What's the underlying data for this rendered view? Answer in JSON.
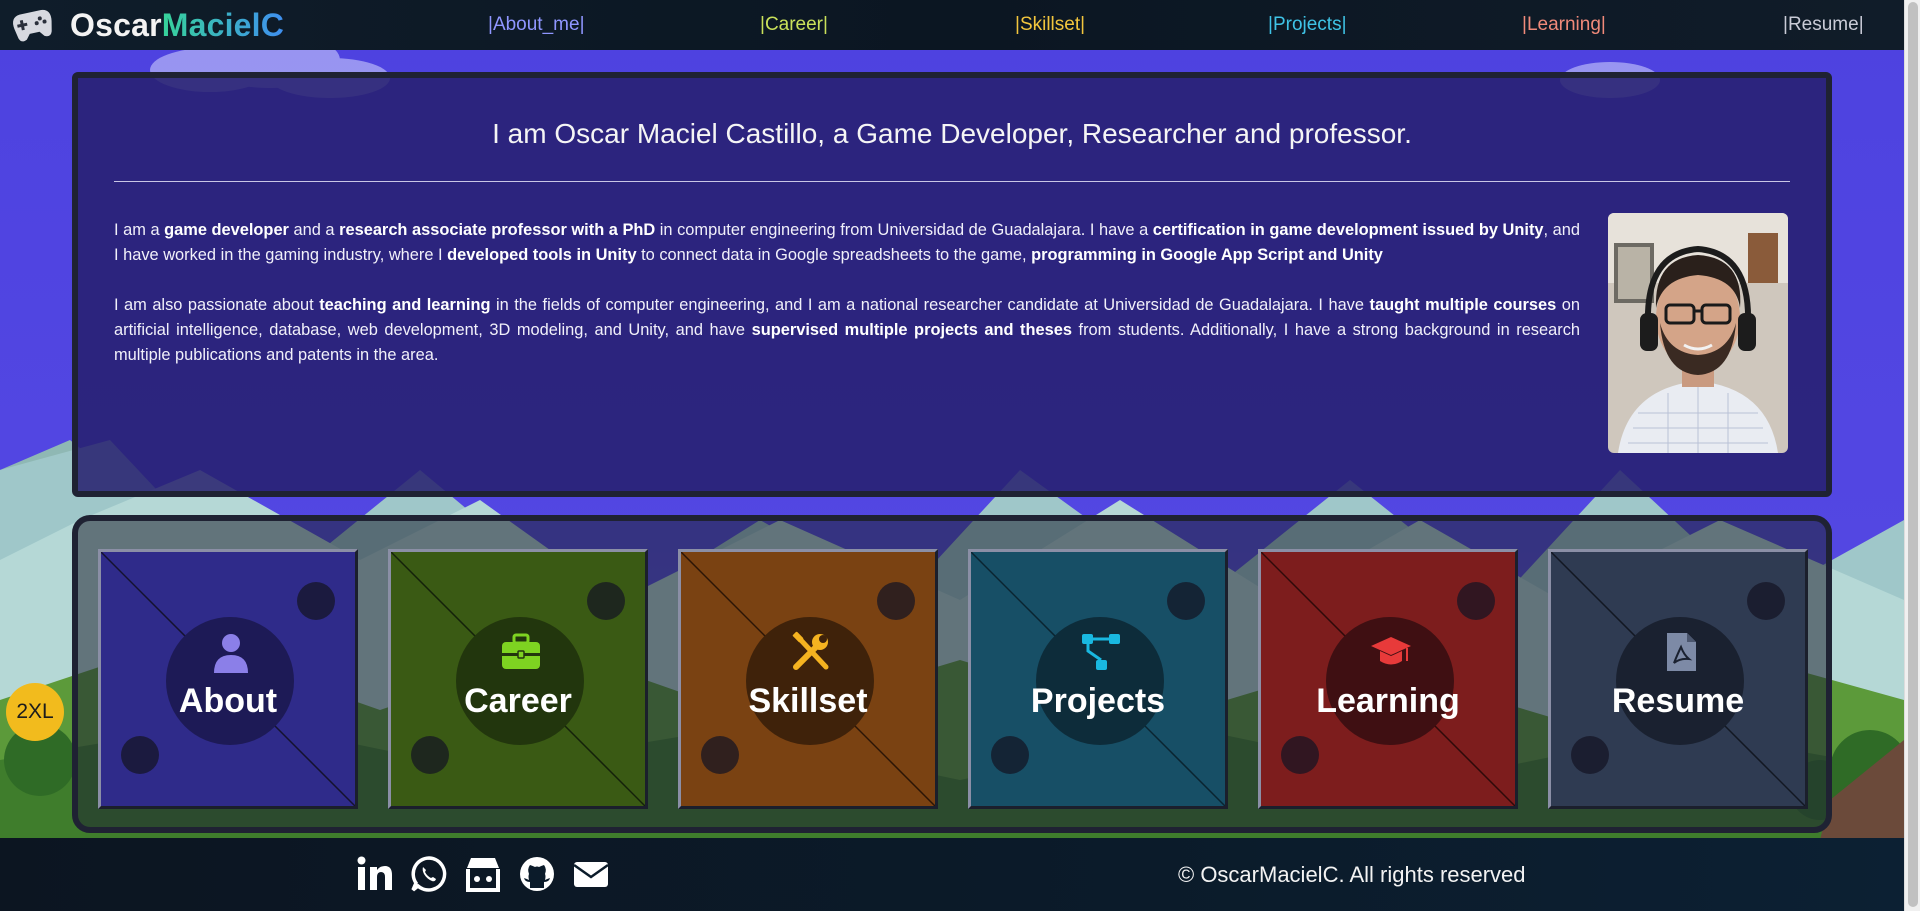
{
  "brand": {
    "name_part1": "Oscar",
    "name_part2": "MacielC",
    "logo_icon": "gamepad-icon"
  },
  "nav": [
    {
      "label": "About_me",
      "color": "#8f96ff"
    },
    {
      "label": "Career",
      "color": "#c9e05a"
    },
    {
      "label": "Skillset",
      "color": "#f2c53d"
    },
    {
      "label": "Projects",
      "color": "#3fc3e6"
    },
    {
      "label": "Learning",
      "color": "#f08a7a"
    },
    {
      "label": "Resume",
      "color": "#c9cbd6"
    }
  ],
  "intro": {
    "title": "I am Oscar Maciel Castillo, a Game Developer, Researcher and professor.",
    "p1": [
      "I am a ",
      "game developer",
      " and a ",
      "research associate professor with a PhD",
      " in computer engineering from Universidad de Guadalajara. I have a ",
      "certification in game development issued by Unity",
      ", and I have worked in the gaming industry, where I ",
      "developed tools in Unity",
      " to connect data in Google spreadsheets to the game, ",
      "programming in Google App Script and Unity"
    ],
    "p2": [
      "I am also passionate about ",
      "teaching and learning",
      " in the fields of computer engineering, and I am a national researcher candidate at Universidad de Guadalajara. I have ",
      "taught multiple courses",
      " on artificial intelligence, database, web development, 3D modeling, and Unity, and have ",
      "supervised multiple projects and theses",
      " from students. Additionally, I have a strong background in research multiple publications and patents in the area."
    ],
    "photo": "profile-photo"
  },
  "cards": [
    {
      "label": "About",
      "icon": "user-icon",
      "bg": "#2f2b8a",
      "disc": "#1d1a56",
      "icon_color": "#8b7fe8"
    },
    {
      "label": "Career",
      "icon": "briefcase-icon",
      "bg": "#3a5a14",
      "disc": "#22360d",
      "icon_color": "#7ed321"
    },
    {
      "label": "Skillset",
      "icon": "tools-icon",
      "bg": "#7a4212",
      "disc": "#3f220a",
      "icon_color": "#f5b320"
    },
    {
      "label": "Projects",
      "icon": "diagram-icon",
      "bg": "#174f66",
      "disc": "#0d2c3a",
      "icon_color": "#19b8e0"
    },
    {
      "label": "Learning",
      "icon": "graduation-cap-icon",
      "bg": "#7d1d1d",
      "disc": "#3f0f12",
      "icon_color": "#e83a3a"
    },
    {
      "label": "Resume",
      "icon": "pdf-file-icon",
      "bg": "#2f3b52",
      "disc": "#1a2130",
      "icon_color": "#7d8aa6"
    }
  ],
  "badge": "2XL",
  "footer": {
    "social": [
      "linkedin-icon",
      "whatsapp-icon",
      "store-icon",
      "github-icon",
      "envelope-icon"
    ],
    "copyright": "© OscarMacielC. All rights reserved"
  }
}
